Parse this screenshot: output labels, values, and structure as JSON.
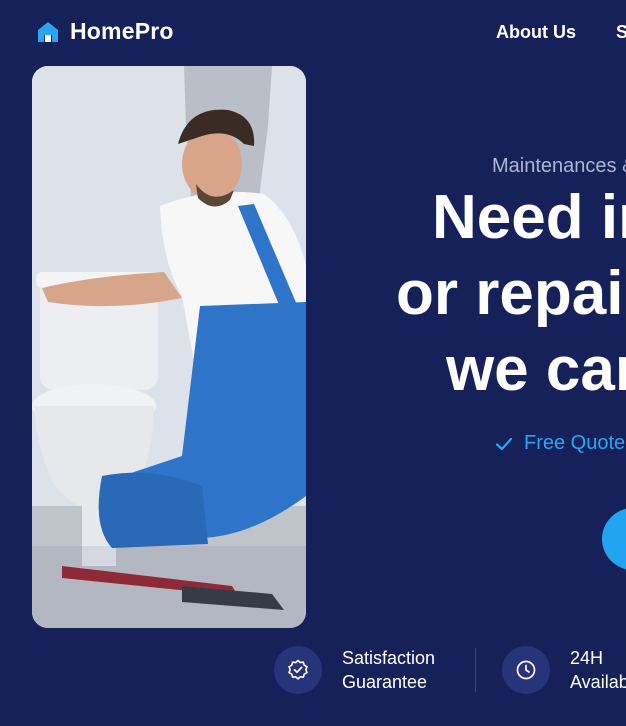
{
  "header": {
    "logo_text": "HomePro",
    "nav": [
      {
        "label": "About Us"
      },
      {
        "label": "Services"
      }
    ]
  },
  "hero": {
    "eyebrow": "Maintenances & Repairs",
    "headline_lines": [
      "Need installation",
      "or repair services?",
      "we can help!"
    ],
    "quote_text": "Free Quote",
    "cta_label": ""
  },
  "features": [
    {
      "icon": "badge-check-icon",
      "line1": "Satisfaction",
      "line2": "Guarantee"
    },
    {
      "icon": "clock-icon",
      "line1": "24H",
      "line2": "Available"
    }
  ],
  "colors": {
    "background": "#16215a",
    "accent": "#22a4f0",
    "icon_circle": "#27347a",
    "muted_text": "#aeb6cf"
  }
}
